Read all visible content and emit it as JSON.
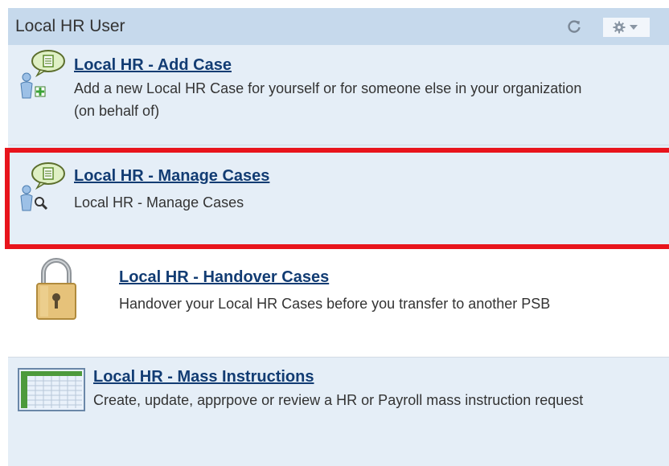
{
  "header": {
    "title": "Local HR User",
    "refresh_icon": "refresh-icon",
    "settings_icon": "gear-icon"
  },
  "items": [
    {
      "title": "Local HR - Add Case",
      "description": "Add a new Local HR Case for yourself or for someone else in your organization (on behalf of)",
      "icon": "person-chat-add-icon"
    },
    {
      "title": "Local HR - Manage Cases",
      "description": "Local HR - Manage Cases",
      "icon": "person-chat-search-icon"
    },
    {
      "title": "Local HR - Handover Cases",
      "description": "Handover your Local HR Cases before you transfer to another PSB",
      "icon": "padlock-icon"
    },
    {
      "title": "Local HR - Mass Instructions",
      "description": "Create, update, apprpove or review a HR or Payroll mass instruction request",
      "icon": "spreadsheet-icon"
    }
  ],
  "colors": {
    "header_bg": "#c6d9ec",
    "panel_bg": "#e5eef7",
    "link": "#123c73",
    "highlight": "#e8141c"
  }
}
